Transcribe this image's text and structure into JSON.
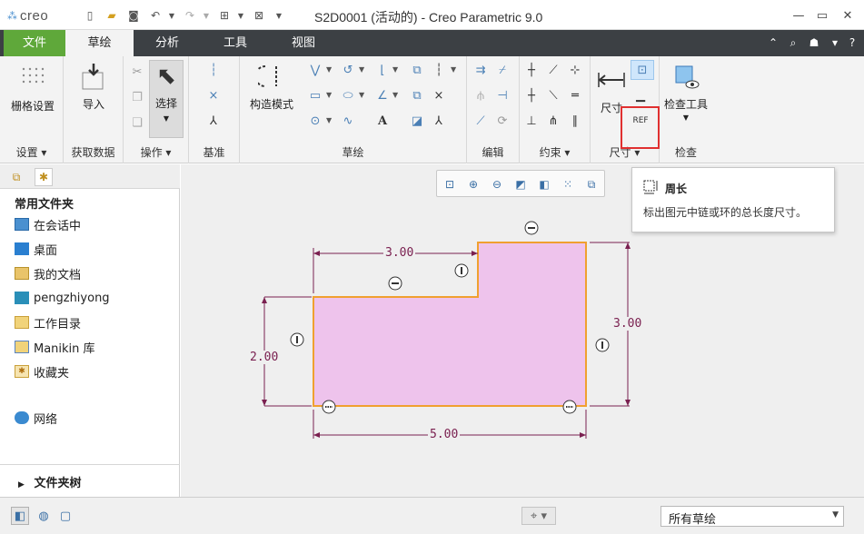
{
  "app": {
    "logo_text": "creo",
    "window_title": "S2D0001 (活动的) - Creo Parametric 9.0"
  },
  "tabs": [
    {
      "label": "文件"
    },
    {
      "label": "草绘"
    },
    {
      "label": "分析"
    },
    {
      "label": "工具"
    },
    {
      "label": "视图"
    }
  ],
  "ribbon": {
    "settings": {
      "grid_label": "栅格设置",
      "group_label": "设置"
    },
    "data": {
      "import_label": "导入",
      "group_label": "获取数据"
    },
    "operations": {
      "select_label": "选择",
      "group_label": "操作"
    },
    "datum": {
      "group_label": "基准"
    },
    "sketch": {
      "construction_label": "构造模式",
      "group_label": "草绘"
    },
    "edit": {
      "group_label": "编辑"
    },
    "constraints": {
      "group_label": "约束"
    },
    "dimension": {
      "dim_label": "尺寸",
      "group_label": "尺寸"
    },
    "inspect": {
      "tool_label": "检查工具",
      "group_label": "检查"
    }
  },
  "tooltip": {
    "title": "周长",
    "description": "标出图元中链或环的总长度尺寸。"
  },
  "left_panel": {
    "favorites_title": "常用文件夹",
    "items": [
      {
        "label": "在会话中",
        "icon": "monitor-icon"
      },
      {
        "label": "桌面",
        "icon": "desktop-icon"
      },
      {
        "label": "我的文档",
        "icon": "documents-icon"
      },
      {
        "label": "pengzhiyong",
        "icon": "user-computer-icon"
      },
      {
        "label": "工作目录",
        "icon": "folder-icon"
      },
      {
        "label": "Manikin 库",
        "icon": "library-icon"
      },
      {
        "label": "收藏夹",
        "icon": "favorites-icon"
      },
      {
        "label": "网络",
        "icon": "network-icon"
      }
    ],
    "folder_tree_label": "文件夹树"
  },
  "sketch": {
    "dimensions": {
      "top": "3.00",
      "left": "2.00",
      "right": "3.00",
      "bottom": "5.00"
    },
    "fill_color": "#eec3ec",
    "outline_color": "#f0a030",
    "dimension_color": "#7a2050"
  },
  "status_bar": {
    "filter_value": "所有草绘"
  },
  "colors": {
    "file_tab": "#5fa83a",
    "tabbar": "#3c4044",
    "highlight": "#e03030",
    "accent": "#4a7fb5"
  }
}
